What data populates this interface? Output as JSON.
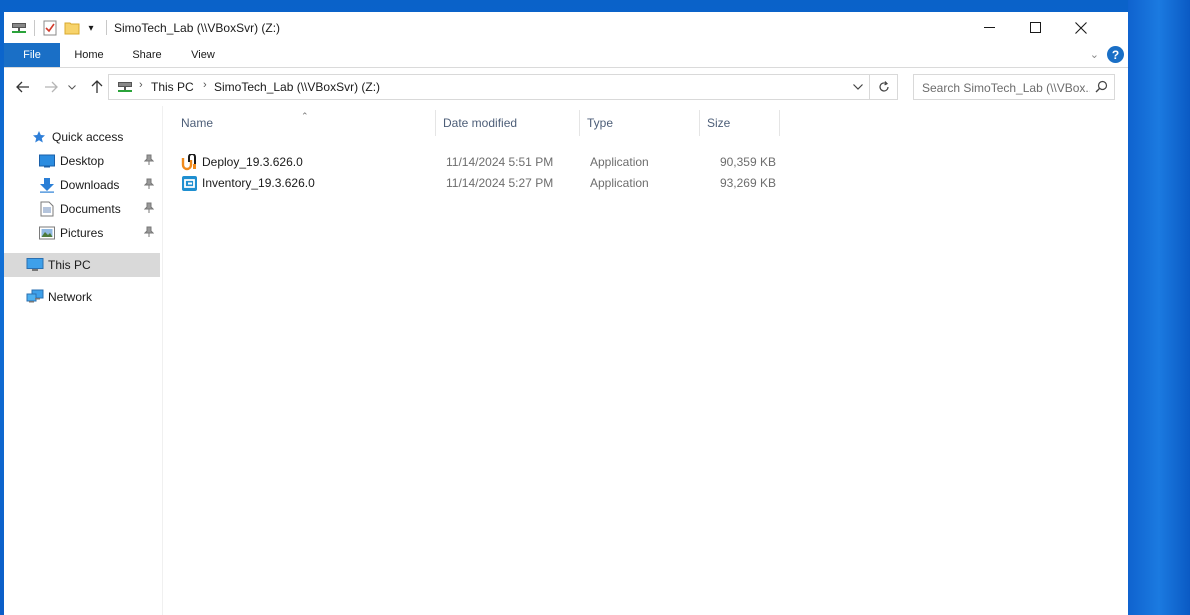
{
  "window": {
    "title": "SimoTech_Lab (\\\\VBoxSvr) (Z:)"
  },
  "ribbon": {
    "tabs": [
      {
        "label": "File"
      },
      {
        "label": "Home"
      },
      {
        "label": "Share"
      },
      {
        "label": "View"
      }
    ]
  },
  "address": {
    "crumbs": [
      "This PC",
      "SimoTech_Lab (\\\\VBoxSvr) (Z:)"
    ]
  },
  "search": {
    "placeholder": "Search SimoTech_Lab (\\\\VBox..."
  },
  "navpane": {
    "quick_access": "Quick access",
    "items": [
      {
        "label": "Desktop",
        "icon": "desktop-icon",
        "pinned": true
      },
      {
        "label": "Downloads",
        "icon": "download-icon",
        "pinned": true
      },
      {
        "label": "Documents",
        "icon": "documents-icon",
        "pinned": true
      },
      {
        "label": "Pictures",
        "icon": "pictures-icon",
        "pinned": true
      }
    ],
    "this_pc": "This PC",
    "network": "Network"
  },
  "columns": {
    "name": "Name",
    "date": "Date modified",
    "type": "Type",
    "size": "Size"
  },
  "files": [
    {
      "name": "Deploy_19.3.626.0",
      "date": "11/14/2024 5:51 PM",
      "type": "Application",
      "size": "90,359 KB",
      "icon": "deploy-app-icon"
    },
    {
      "name": "Inventory_19.3.626.0",
      "date": "11/14/2024 5:27 PM",
      "type": "Application",
      "size": "93,269 KB",
      "icon": "inventory-app-icon"
    }
  ],
  "colors": {
    "accent": "#1a6fc6",
    "selected_nav": "#d9d9d9",
    "desktop": "#0a62c9"
  }
}
